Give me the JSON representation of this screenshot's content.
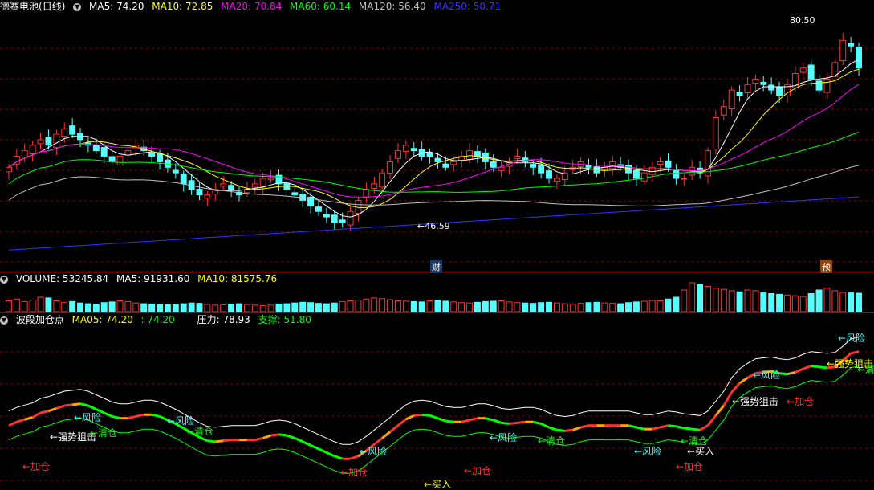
{
  "header": {
    "stock_name": "德赛电池",
    "period": "(日线)",
    "ma": [
      {
        "label": "MA5: 74.20",
        "color": "#ffffff"
      },
      {
        "label": "MA10: 72.85",
        "color": "#ffff00"
      },
      {
        "label": "MA20: 70.84",
        "color": "#ff00ff"
      },
      {
        "label": "MA60: 60.14",
        "color": "#00ff00"
      },
      {
        "label": "MA120: 56.40",
        "color": "#c0c0c0"
      },
      {
        "label": "MA250: 50.71",
        "color": "#3333ff"
      }
    ]
  },
  "volume_header": {
    "label": "VOLUME: 53245.84",
    "ma5": "MA5: 91931.60",
    "ma10": "MA10: 81575.76"
  },
  "wave_header": {
    "title": "波段加仓点",
    "ma05": "MA05: 74.20",
    "ma05b": ": 74.20",
    "pressure": "压力: 78.93",
    "support": "支撑: 51.80"
  },
  "markers": {
    "high": "80.50",
    "low": "←46.59",
    "cai": "财",
    "yu": "预"
  },
  "colors": {
    "up": "#ff3232",
    "down": "#54ffff",
    "grid": "#8b0000",
    "ma5": "#ffffff",
    "ma10": "#ffff00",
    "ma20": "#ff00ff",
    "ma60": "#00ff00",
    "ma120": "#c0c0c0",
    "ma250": "#3333ff"
  },
  "chart_data": [
    {
      "type": "candlestick",
      "title": "德赛电池 (日线)",
      "price_range": [
        40,
        85
      ],
      "high_label": 80.5,
      "low_label": 46.59,
      "close_series": [
        57,
        59,
        60,
        61,
        62,
        61,
        63,
        64,
        63,
        62,
        61,
        60,
        59,
        58,
        59,
        60,
        61,
        60,
        59,
        58,
        57,
        56,
        54,
        53,
        52,
        52,
        53,
        54,
        53,
        52,
        53,
        54,
        55,
        55,
        54,
        53,
        52,
        51,
        50,
        49,
        48,
        47,
        47,
        49,
        51,
        53,
        54,
        56,
        58,
        60,
        61,
        60,
        59,
        59,
        58,
        57,
        58,
        59,
        60,
        59,
        58,
        57,
        57,
        58,
        59,
        58,
        57,
        56,
        55,
        55,
        56,
        57,
        58,
        57,
        56,
        57,
        58,
        57,
        56,
        55,
        56,
        57,
        58,
        57,
        55,
        55,
        57,
        56,
        60,
        66,
        68,
        71,
        70,
        72,
        73,
        72,
        71,
        70,
        72,
        74,
        75,
        73,
        71,
        73,
        76,
        80,
        79,
        75
      ]
    },
    {
      "type": "bar",
      "title": "VOLUME",
      "series": [
        {
          "name": "VOLUME",
          "values": [
            30,
            35,
            28,
            32,
            40,
            38,
            30,
            26,
            28,
            24,
            22,
            20,
            25,
            27,
            30,
            28,
            24,
            22,
            21,
            20,
            19,
            20,
            22,
            24,
            23,
            20,
            18,
            19,
            21,
            22,
            20,
            18,
            17,
            18,
            21,
            22,
            24,
            26,
            25,
            23,
            22,
            24,
            28,
            30,
            32,
            35,
            38,
            36,
            33,
            30,
            29,
            28,
            27,
            30,
            32,
            29,
            27,
            25,
            24,
            26,
            28,
            29,
            30,
            27,
            25,
            24,
            23,
            25,
            26,
            24,
            22,
            21,
            23,
            25,
            26,
            24,
            23,
            22,
            25,
            27,
            29,
            31,
            30,
            35,
            40,
            60,
            80,
            75,
            70,
            65,
            62,
            58,
            55,
            60,
            58,
            52,
            50,
            48,
            46,
            44,
            42,
            50,
            60,
            65,
            58,
            53,
            52,
            51
          ]
        }
      ]
    },
    {
      "type": "line",
      "title": "波段加仓点",
      "labels": [
        "←加仓",
        "←强势狙击",
        "←清仓",
        "←风险",
        "←风险",
        "←清仓",
        "←风险",
        "←加仓",
        "←风险",
        "←清仓",
        "←买入",
        "←加仓",
        "←风险",
        "←清仓",
        "←买入",
        "←加仓",
        "←强势狙击",
        "←加仓",
        "←风险",
        "←风险",
        "←强势狙击",
        "←清仓"
      ]
    }
  ]
}
